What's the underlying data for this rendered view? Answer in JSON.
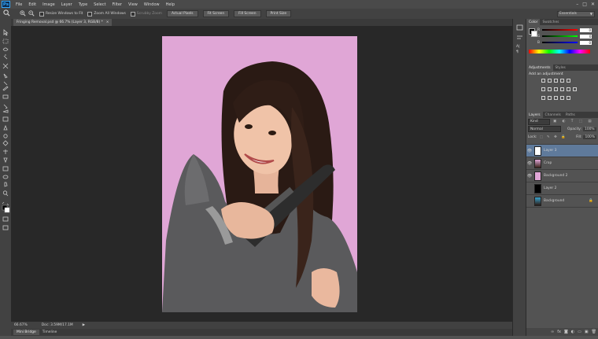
{
  "app": {
    "logo": "Ps"
  },
  "menu": [
    "File",
    "Edit",
    "Image",
    "Layer",
    "Type",
    "Select",
    "Filter",
    "View",
    "Window",
    "Help"
  ],
  "window_controls": [
    "–",
    "□",
    "✕"
  ],
  "options_bar": {
    "zoom_glyph": "🔍",
    "options": [
      "Resize Windows to Fit",
      "Zoom All Windows",
      "Scrubby Zoom"
    ],
    "buttons": [
      "Actual Pixels",
      "Fit Screen",
      "Fill Screen",
      "Print Size"
    ],
    "workspace": "Essentials"
  },
  "document_tab": {
    "title": "Fringing Removal.psd @ 66.7% (Layer 3, RGB/8) *",
    "close": "×"
  },
  "status_bar": {
    "zoom": "66.67%",
    "doc": "Doc: 3.59M/17.1M",
    "arrow": "▶"
  },
  "bottom_tabs": [
    "Mini Bridge",
    "Timeline"
  ],
  "color_panel": {
    "tabs": [
      "Color",
      "Swatches"
    ],
    "channels": [
      {
        "label": "R",
        "value": "0"
      },
      {
        "label": "G",
        "value": "0"
      },
      {
        "label": "B",
        "value": "0"
      }
    ]
  },
  "adjustments_panel": {
    "tabs": [
      "Adjustments",
      "Styles"
    ],
    "title": "Add an adjustment"
  },
  "layers_panel": {
    "tabs": [
      "Layers",
      "Channels",
      "Paths"
    ],
    "filter": "Kind",
    "blend_mode": "Normal",
    "opacity_label": "Opacity:",
    "opacity_value": "100%",
    "lock_label": "Lock:",
    "fill_label": "Fill:",
    "fill_value": "100%",
    "layers": [
      {
        "name": "Layer 3",
        "visible": true,
        "selected": true
      },
      {
        "name": "Crop",
        "visible": true,
        "selected": false
      },
      {
        "name": "Background 2",
        "visible": true,
        "selected": false
      },
      {
        "name": "Layer 2",
        "visible": false,
        "selected": false
      },
      {
        "name": "Background",
        "visible": false,
        "selected": false,
        "locked": true
      }
    ],
    "footer_icons": [
      "link-icon",
      "fx-icon",
      "mask-icon",
      "adjustment-icon",
      "group-icon",
      "new-layer-icon",
      "trash-icon"
    ]
  },
  "colors": {
    "accent_selection": "#5f7a9b",
    "canvas_bg": "#282828",
    "photo_bg": "#e0a6d6"
  }
}
